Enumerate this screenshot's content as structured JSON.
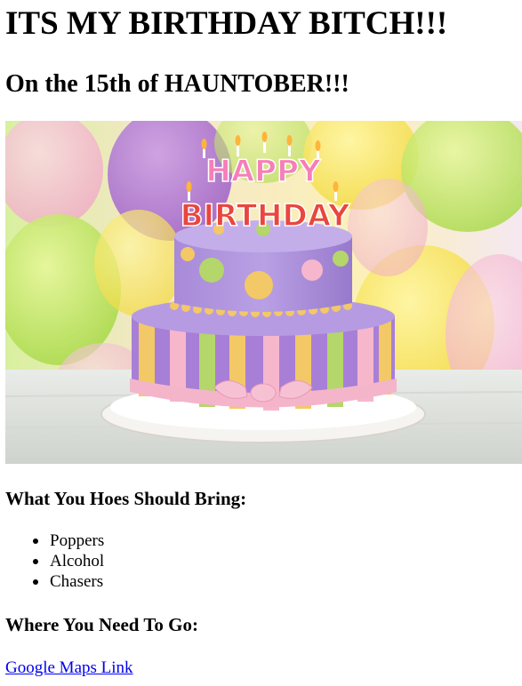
{
  "page": {
    "title": "ITS MY BIRTHDAY BITCH!!!",
    "subtitle": "On the 15th of HAUNTOBER!!!"
  },
  "image": {
    "cake_text_line1": "HAPPY",
    "cake_text_line2": "BIRTHDAY"
  },
  "bring": {
    "heading": "What You Hoes Should Bring:",
    "items": [
      "Poppers",
      "Alcohol",
      "Chasers"
    ]
  },
  "where": {
    "heading": "Where You Need To Go:",
    "link_label": "Google Maps Link"
  },
  "colors": {
    "link": "#0000ee",
    "text": "#000000"
  }
}
